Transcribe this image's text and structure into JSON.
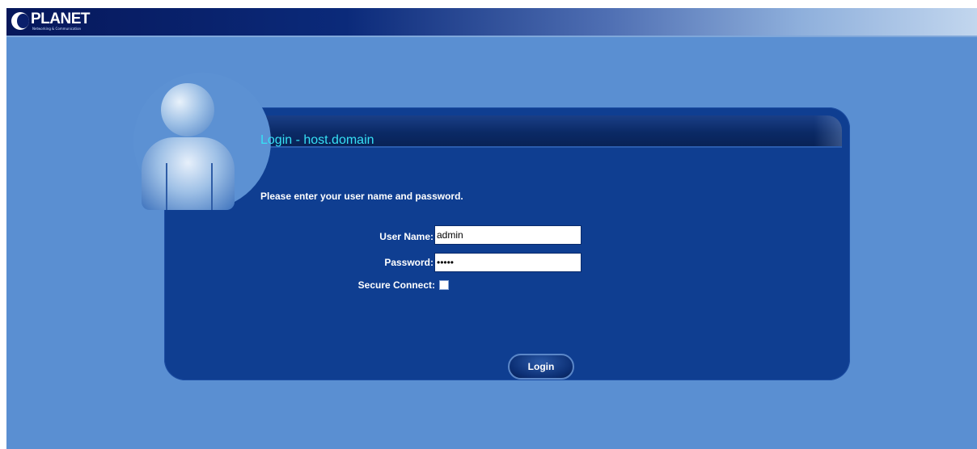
{
  "brand": {
    "name": "PLANET",
    "tagline": "Networking & Communication"
  },
  "login": {
    "title": "Login - host.domain",
    "prompt": "Please enter your user name and password.",
    "user_label": "User Name:",
    "user_value": "admin",
    "password_label": "Password:",
    "password_value": "*****",
    "secure_label": "Secure Connect:",
    "secure_checked": false,
    "button_label": "Login"
  },
  "colors": {
    "background": "#5a8fd2",
    "panel": "#0f3e91",
    "title_text": "#36e0f5"
  }
}
